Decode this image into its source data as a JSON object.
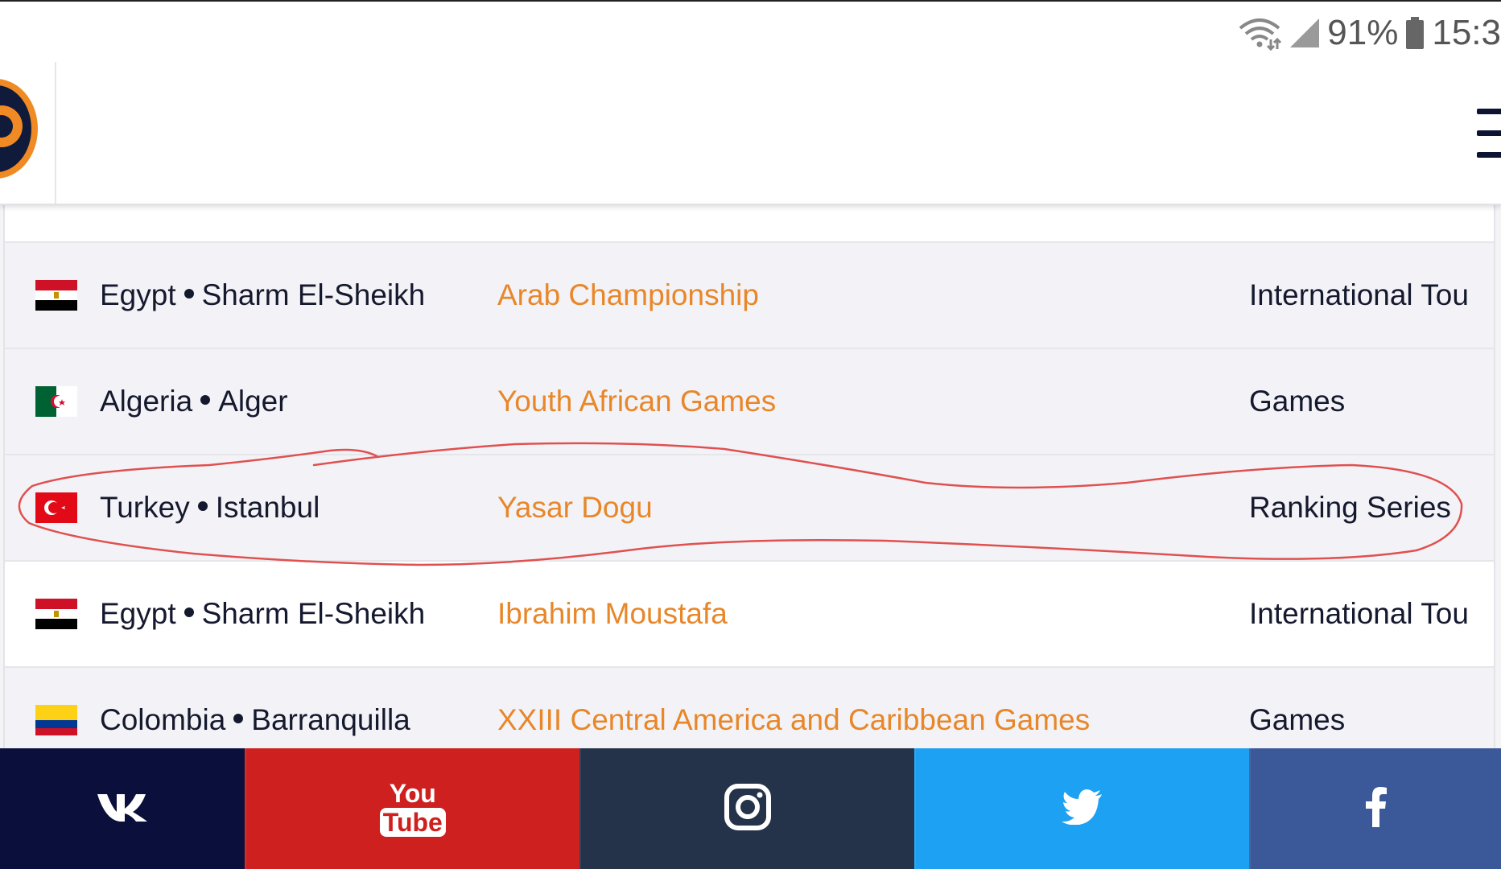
{
  "status_bar": {
    "battery": "91%",
    "time": "15:3"
  },
  "header": {
    "logo_icon": "wrestling-logo",
    "menu_icon": "hamburger-menu-icon"
  },
  "rows": [
    {
      "flag": "egypt",
      "country": "Egypt",
      "city": "Sharm El-Sheikh",
      "event": "Arab Championship",
      "type": "International Tou"
    },
    {
      "flag": "algeria",
      "country": "Algeria",
      "city": "Alger",
      "event": "Youth African Games",
      "type": "Games"
    },
    {
      "flag": "turkey",
      "country": "Turkey",
      "city": "Istanbul",
      "event": "Yasar Dogu",
      "type": "Ranking Series"
    },
    {
      "flag": "egypt",
      "country": "Egypt",
      "city": "Sharm El-Sheikh",
      "event": "Ibrahim Moustafa",
      "type": "International Tou"
    },
    {
      "flag": "colombia",
      "country": "Colombia",
      "city": "Barranquilla",
      "event": "XXIII Central America and Caribbean Games",
      "type": "Games"
    }
  ],
  "footer": {
    "buttons": [
      {
        "name": "vk",
        "icon": "vk-icon",
        "color": "#0b0f3b"
      },
      {
        "name": "youtube",
        "icon": "youtube-icon",
        "color": "#cd201f",
        "label_top": "You",
        "label_bottom": "Tube"
      },
      {
        "name": "instagram",
        "icon": "instagram-icon",
        "color": "#24334a"
      },
      {
        "name": "twitter",
        "icon": "twitter-icon",
        "color": "#1da1f2"
      },
      {
        "name": "facebook",
        "icon": "facebook-icon",
        "color": "#3b5998"
      }
    ]
  },
  "colors": {
    "event_link": "#e8872a",
    "text_dark": "#15192e",
    "annotation": "#e05050"
  }
}
